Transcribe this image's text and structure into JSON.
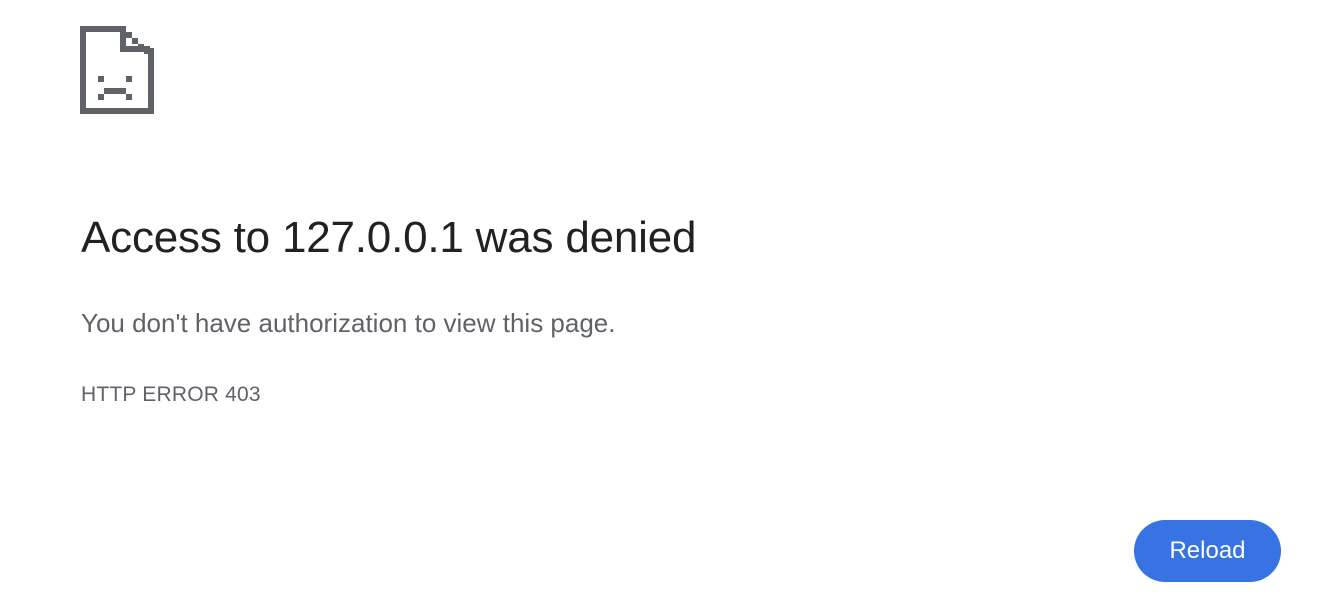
{
  "icon": "sad-file-icon",
  "colors": {
    "icon": "#5f6368",
    "title": "#202124",
    "body_text": "#5f6368",
    "button_bg": "#3773e3",
    "button_text": "#ffffff",
    "background": "#ffffff"
  },
  "error": {
    "title": "Access to 127.0.0.1 was denied",
    "message": "You don't have authorization to view this page.",
    "code": "HTTP ERROR 403"
  },
  "actions": {
    "reload_label": "Reload"
  }
}
